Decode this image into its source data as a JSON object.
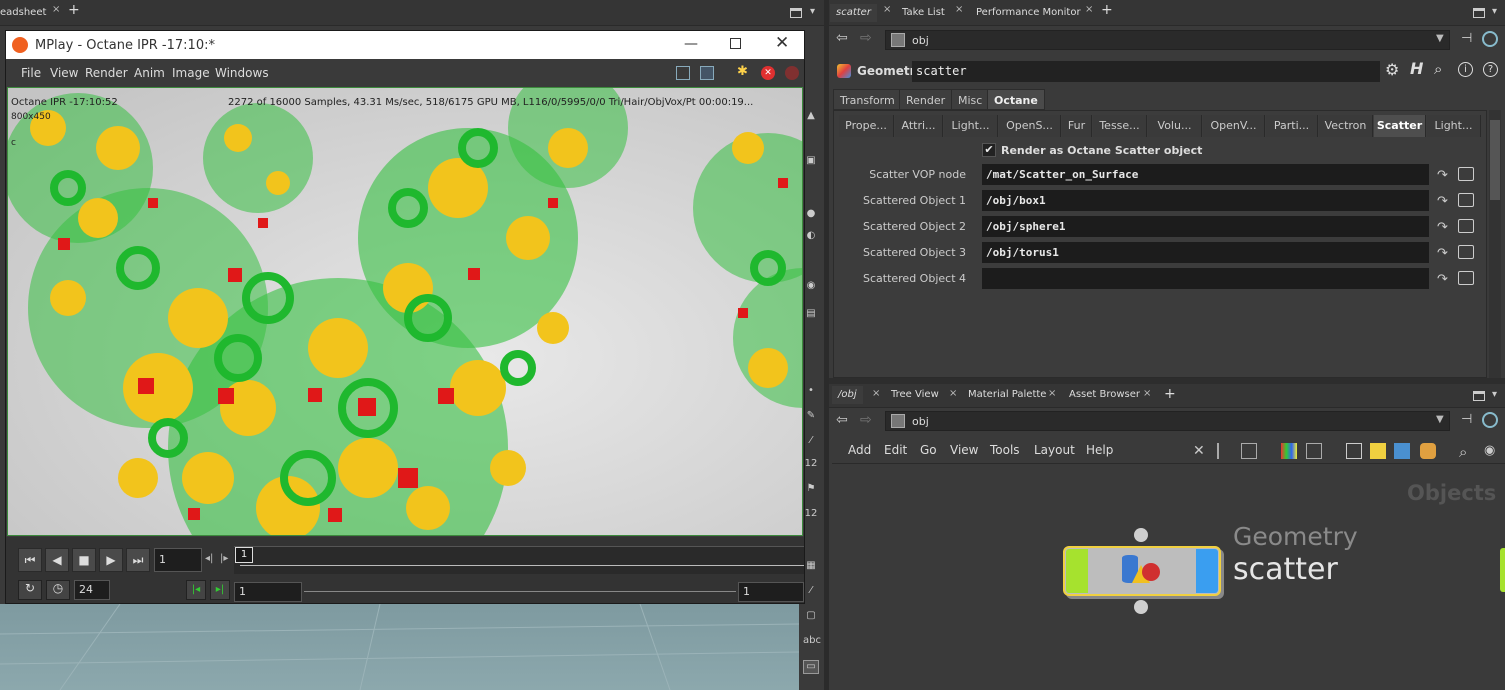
{
  "left_top_tab": {
    "label": "eadsheet",
    "close": "×",
    "add": "+"
  },
  "right_top_tabs": [
    {
      "label": "scatter",
      "close": "×"
    },
    {
      "label": "Take List",
      "close": "×"
    },
    {
      "label": "Performance Monitor",
      "close": "×"
    }
  ],
  "add_tab": "+",
  "path_top": "obj",
  "param_header": {
    "type": "Geometry",
    "name": "scatter"
  },
  "param_tabs": [
    "Transform",
    "Render",
    "Misc",
    "Octane"
  ],
  "param_subtabs": [
    "Prope...",
    "Attri...",
    "Light...",
    "OpenS...",
    "Fur",
    "Tesse...",
    "Volu...",
    "OpenV...",
    "Parti...",
    "Vectron",
    "Scatter",
    "Light..."
  ],
  "checkbox_label": "Render as Octane Scatter object",
  "params": [
    {
      "label": "Scatter VOP node",
      "value": "/mat/Scatter_on_Surface"
    },
    {
      "label": "Scattered Object 1",
      "value": "/obj/box1"
    },
    {
      "label": "Scattered Object 2",
      "value": "/obj/sphere1"
    },
    {
      "label": "Scattered Object 3",
      "value": "/obj/torus1"
    },
    {
      "label": "Scattered Object 4",
      "value": ""
    }
  ],
  "bottom_tabs": [
    {
      "label": "/obj",
      "close": "×"
    },
    {
      "label": "Tree View",
      "close": "×"
    },
    {
      "label": "Material Palette",
      "close": "×"
    },
    {
      "label": "Asset Browser",
      "close": "×"
    }
  ],
  "path_bottom": "obj",
  "network_menu": [
    "Add",
    "Edit",
    "Go",
    "View",
    "Tools",
    "Layout",
    "Help"
  ],
  "network_context": "Objects",
  "node": {
    "type": "Geometry",
    "name": "scatter"
  },
  "mplay": {
    "title": "MPlay - Octane IPR -17:10:*",
    "menu": [
      "File",
      "View",
      "Render",
      "Anim",
      "Image",
      "Windows"
    ],
    "overlay_left": "Octane IPR -17:10:52",
    "overlay_res": "800x450",
    "overlay_c": "c",
    "overlay_stats": "2272 of 16000 Samples, 43.31 Ms/sec, 518/6175 GPU MB, L116/0/5995/0/0 Tri/Hair/ObjVox/Pt 00:00:19...",
    "frame_field": "1",
    "frame_marker": "1",
    "fps": "24",
    "range_start": "1",
    "range_end": "1"
  },
  "left_toolbar_labels": [
    "12",
    "12",
    "abc"
  ],
  "colors": {
    "accent_yellow": "#f0d040",
    "node_green": "#a6e22e",
    "node_blue": "#3a9ef0",
    "viewport_bg": "#c8c8c8"
  }
}
